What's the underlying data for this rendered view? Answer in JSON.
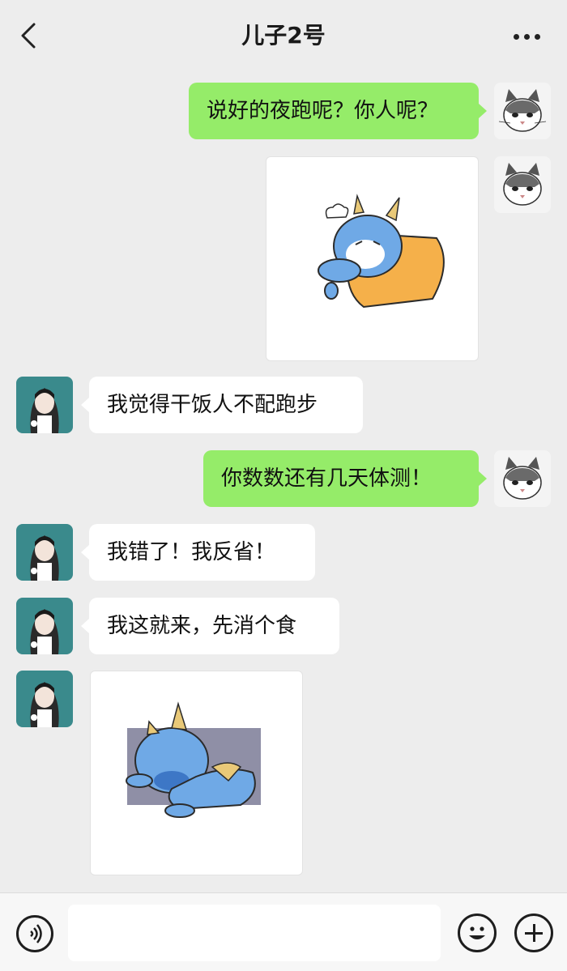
{
  "header": {
    "title": "儿子2号",
    "back_icon": "chevron-left-icon",
    "more_icon": "more-dots-icon"
  },
  "messages": [
    {
      "sender": "me",
      "type": "text",
      "text": "说好的夜跑呢？你人呢？"
    },
    {
      "sender": "me",
      "type": "sticker",
      "sticker": "blue-dragon-lying-on-pillow"
    },
    {
      "sender": "other",
      "type": "text",
      "text": "我觉得干饭人不配跑步"
    },
    {
      "sender": "me",
      "type": "text",
      "text": "你数数还有几天体测！"
    },
    {
      "sender": "other",
      "type": "text",
      "text": "我错了！我反省！"
    },
    {
      "sender": "other",
      "type": "text",
      "text": "我这就来，先消个食"
    },
    {
      "sender": "other",
      "type": "sticker",
      "sticker": "blue-dragon-lying-flat"
    }
  ],
  "input_bar": {
    "placeholder": "",
    "voice_icon": "voice-icon",
    "emoji_icon": "emoji-icon",
    "plus_icon": "plus-icon"
  },
  "colors": {
    "background": "#ededed",
    "my_bubble": "#95ec69",
    "other_bubble": "#ffffff"
  }
}
